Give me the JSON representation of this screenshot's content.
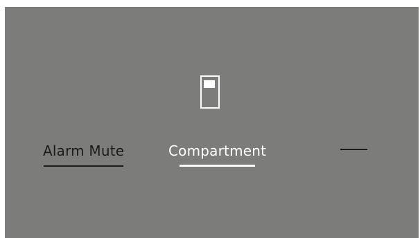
{
  "menu": {
    "items": [
      {
        "label": "Alarm Mute",
        "selected": false
      },
      {
        "label": "Compartment",
        "selected": true
      },
      {
        "label": "",
        "selected": false
      }
    ]
  },
  "icons": {
    "compartment": "refrigerator-compartment-icon"
  },
  "colors": {
    "background": "#7c7d7b",
    "selected_text": "#ffffff",
    "unselected_text": "#1c1c1c"
  }
}
